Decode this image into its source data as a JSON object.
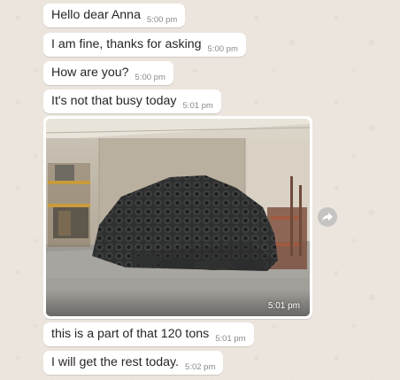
{
  "messages": [
    {
      "text": "Hello dear Anna",
      "time": "5:00 pm"
    },
    {
      "text": "I am fine, thanks for asking",
      "time": "5:00 pm"
    },
    {
      "text": "How are you?",
      "time": "5:00 pm"
    },
    {
      "text": "It's not that busy today",
      "time": "5:01 pm"
    },
    {
      "image": "warehouse-photo",
      "time": "5:01 pm"
    },
    {
      "text": "this is a part of that 120 tons",
      "time": "5:01 pm"
    },
    {
      "text": "I will get the rest today.",
      "time": "5:02 pm"
    }
  ],
  "icons": {
    "forward": "forward-arrow-icon"
  },
  "colors": {
    "chat_background": "#ece5dd",
    "bubble": "#ffffff",
    "text": "#262626",
    "timestamp": "#8a8a8a"
  }
}
